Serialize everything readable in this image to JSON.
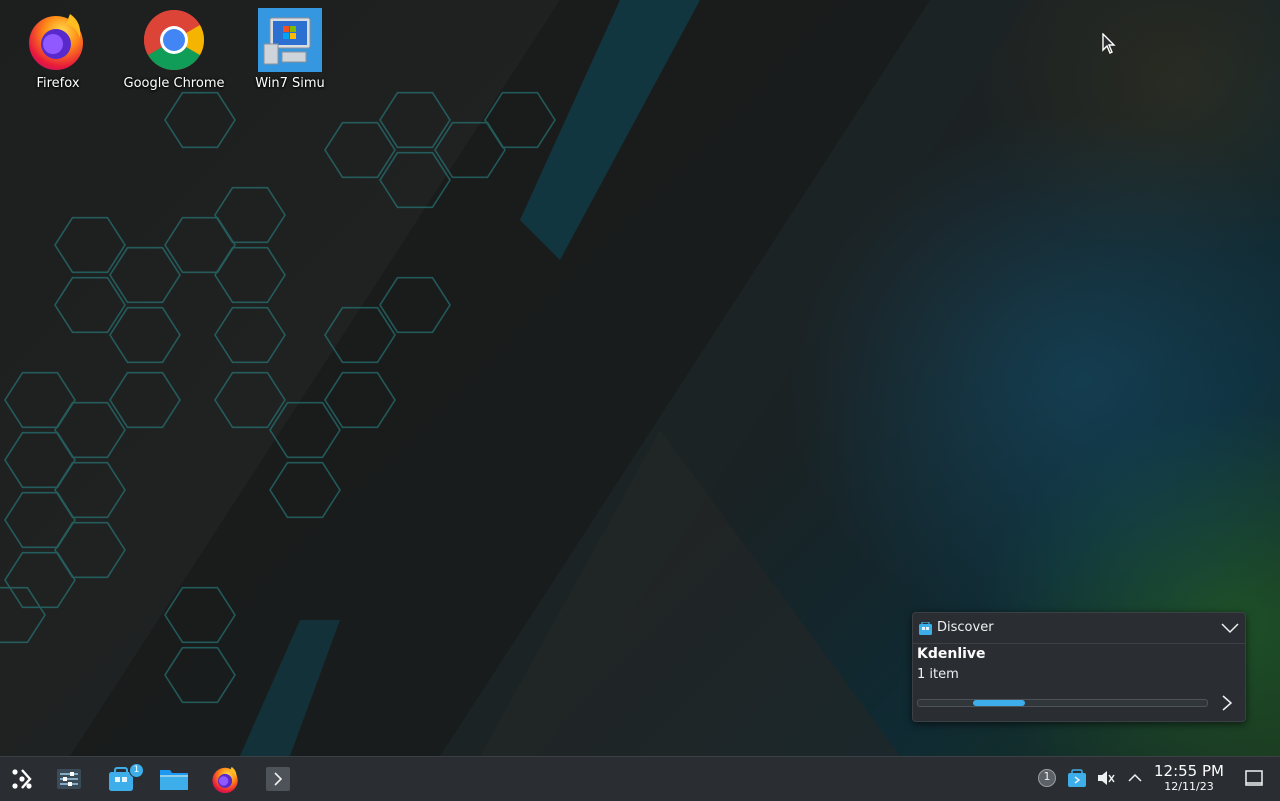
{
  "desktop": {
    "icons": [
      {
        "label": "Firefox",
        "icon": "firefox-icon"
      },
      {
        "label": "Google Chrome",
        "icon": "chrome-icon"
      },
      {
        "label": "Win7 Simu",
        "icon": "win7-simu-icon"
      }
    ]
  },
  "notification": {
    "app_name": "Discover",
    "app_icon": "discover-icon",
    "title": "Kdenlive",
    "body": "1 item",
    "progress": 0.31,
    "progress_start": 0.19,
    "progress_color": "#3daee9"
  },
  "taskbar": {
    "launcher_icon": "application-launcher-icon",
    "pinned": [
      {
        "name": "system-settings",
        "icon": "system-settings-icon"
      },
      {
        "name": "discover",
        "icon": "discover-icon",
        "badge": "1"
      },
      {
        "name": "file-manager",
        "icon": "folder-icon"
      },
      {
        "name": "firefox",
        "icon": "firefox-icon"
      },
      {
        "name": "terminal",
        "icon": "terminal-icon"
      }
    ],
    "tray": {
      "notification_count": "1",
      "icons": [
        "notification-count-icon",
        "discover-updates-icon",
        "volume-muted-icon",
        "show-hidden-chevron-icon"
      ]
    },
    "clock": {
      "time": "12:55 PM",
      "date": "12/11/23"
    },
    "show_desktop_icon": "show-desktop-icon"
  },
  "colors": {
    "panel": "#2a2e32",
    "accent": "#3daee9",
    "hex_glow": "#2a8c8c"
  }
}
